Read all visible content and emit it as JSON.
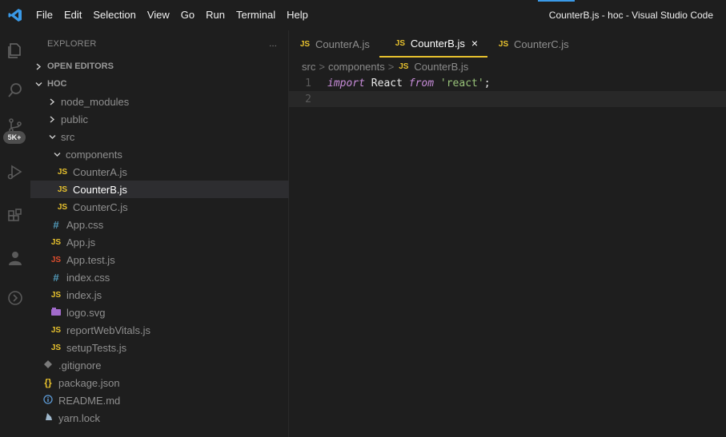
{
  "menu": [
    "File",
    "Edit",
    "Selection",
    "View",
    "Go",
    "Run",
    "Terminal",
    "Help"
  ],
  "window_title": "CounterB.js - hoc - Visual Studio Code",
  "activity": {
    "badge": "5K+"
  },
  "explorer": {
    "header": "EXPLORER",
    "more": "...",
    "open_editors": "OPEN EDITORS",
    "project": "HOC",
    "items": [
      {
        "label": "node_modules"
      },
      {
        "label": "public"
      },
      {
        "label": "src"
      },
      {
        "label": "components"
      },
      {
        "label": "CounterA.js",
        "icon": "JS"
      },
      {
        "label": "CounterB.js",
        "icon": "JS"
      },
      {
        "label": "CounterC.js",
        "icon": "JS"
      },
      {
        "label": "App.css",
        "icon": "#"
      },
      {
        "label": "App.js",
        "icon": "JS"
      },
      {
        "label": "App.test.js",
        "icon": "JS"
      },
      {
        "label": "index.css",
        "icon": "#"
      },
      {
        "label": "index.js",
        "icon": "JS"
      },
      {
        "label": "logo.svg"
      },
      {
        "label": "reportWebVitals.js",
        "icon": "JS"
      },
      {
        "label": "setupTests.js",
        "icon": "JS"
      },
      {
        "label": ".gitignore"
      },
      {
        "label": "package.json",
        "icon": "{}"
      },
      {
        "label": "README.md"
      },
      {
        "label": "yarn.lock"
      }
    ]
  },
  "tabs": [
    {
      "label": "CounterA.js",
      "icon": "JS"
    },
    {
      "label": "CounterB.js",
      "icon": "JS",
      "close": "×"
    },
    {
      "label": "CounterC.js",
      "icon": "JS"
    }
  ],
  "breadcrumb": {
    "seg1": "src",
    "seg2": "components",
    "file_icon": "JS",
    "file": "CounterB.js",
    "sep": ">"
  },
  "code": {
    "lines": [
      {
        "number": "1",
        "kw1": "import",
        "id": "React",
        "kw2": "from",
        "str": "'react'",
        "end": ";"
      },
      {
        "number": "2"
      }
    ]
  },
  "colors": {
    "accent_tab": "#e8c22e",
    "js_icon": "#e8c22e",
    "keyword": "#c78cd9",
    "string": "#98c379",
    "title_accent": "#3a9ae8"
  }
}
